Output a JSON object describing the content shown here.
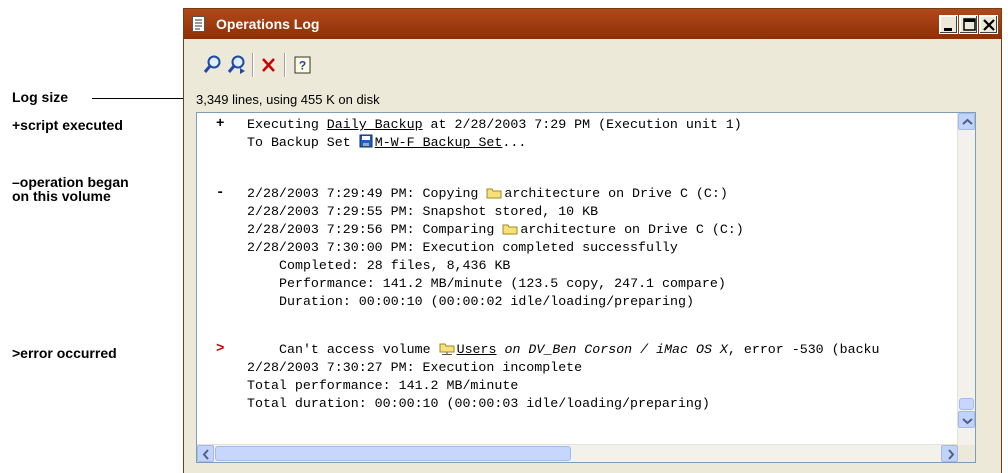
{
  "callouts": {
    "log_size": "Log size",
    "script_executed": "+script executed",
    "operation_began_1": "–operation began",
    "operation_began_2": "on this volume",
    "error_occurred": ">error occurred"
  },
  "window": {
    "title": "Operations Log",
    "controls": [
      "minimize",
      "maximize",
      "close"
    ]
  },
  "toolbar": {
    "buttons": [
      "find-icon",
      "find-next-icon",
      "delete-icon",
      "help-icon"
    ]
  },
  "status": "3,349 lines, using 455 K on disk",
  "log": {
    "l1_marker": "+",
    "l1_pre": "Executing ",
    "l1_script": "Daily Backup",
    "l1_post": " at 2/28/2003 7:29 PM (Execution unit 1)",
    "l2_pre": "To Backup Set ",
    "l2_set": "M-W-F Backup Set",
    "l2_post": "...",
    "l3_marker": "-",
    "l3_pre": "2/28/2003 7:29:49 PM: Copying ",
    "l3_post": "architecture on Drive C (C:)",
    "l4": "2/28/2003 7:29:55 PM: Snapshot stored, 10 KB",
    "l5_pre": "2/28/2003 7:29:56 PM: Comparing ",
    "l5_post": "architecture on Drive C (C:)",
    "l6": "2/28/2003 7:30:00 PM: Execution completed successfully",
    "l7": "Completed: 28 files, 8,436 KB",
    "l8": "Performance: 141.2 MB/minute (123.5 copy, 247.1 compare)",
    "l9": "Duration: 00:00:10 (00:00:02 idle/loading/preparing)",
    "l10_marker": ">",
    "l10_pre": "Can't access volume ",
    "l10_vol": "Users",
    "l10_mid": " on DV_Ben Corson / iMac OS X",
    "l10_post": ", error -530 (backu",
    "l11": "2/28/2003 7:30:27 PM: Execution incomplete",
    "l12": "Total performance: 141.2 MB/minute",
    "l13": "Total duration: 00:00:10 (00:00:03 idle/loading/preparing)"
  },
  "colors": {
    "titlebar": "#993300",
    "error_marker": "#cc0000",
    "delete_icon": "#cc0000",
    "scrollbar": "#c1d3fb"
  }
}
